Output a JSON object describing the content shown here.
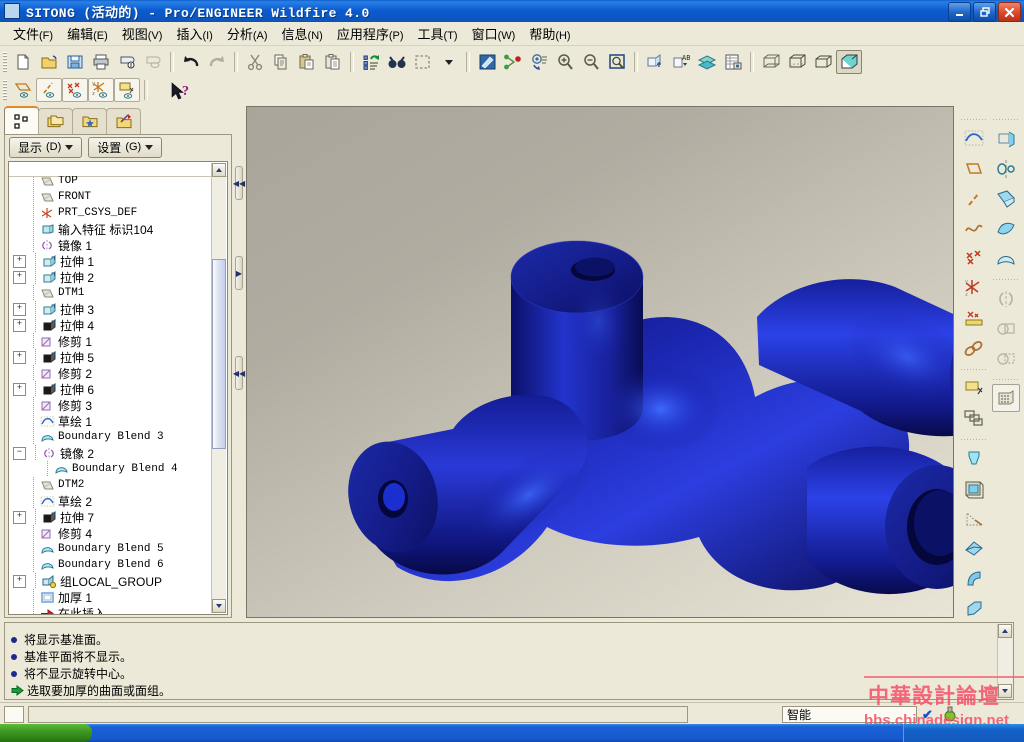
{
  "window": {
    "title": "SITONG (活动的) - Pro/ENGINEER Wildfire 4.0",
    "minimize_label": "_",
    "restore_label": "❐",
    "close_label": "✕",
    "app_icon": "part-window-icon"
  },
  "menubar": {
    "items": [
      {
        "label": "文件",
        "key": "(F)"
      },
      {
        "label": "编辑",
        "key": "(E)"
      },
      {
        "label": "视图",
        "key": "(V)"
      },
      {
        "label": "插入",
        "key": "(I)"
      },
      {
        "label": "分析",
        "key": "(A)"
      },
      {
        "label": "信息",
        "key": "(N)"
      },
      {
        "label": "应用程序",
        "key": "(P)"
      },
      {
        "label": "工具",
        "key": "(T)"
      },
      {
        "label": "窗口",
        "key": "(W)"
      },
      {
        "label": "帮助",
        "key": "(H)"
      }
    ]
  },
  "toolbar_main": {
    "buttons": [
      {
        "name": "new-file-icon",
        "title": "新建"
      },
      {
        "name": "open-file-icon",
        "title": "打开"
      },
      {
        "name": "save-icon",
        "title": "保存"
      },
      {
        "name": "print-icon",
        "title": "打印"
      },
      {
        "name": "send-mail-icon",
        "title": "发送"
      },
      {
        "name": "close-window-icon",
        "title": "关闭窗口"
      },
      {
        "name": "undo-icon",
        "title": "撤消"
      },
      {
        "name": "redo-icon",
        "title": "重做"
      },
      {
        "name": "cut-icon",
        "title": "剪切"
      },
      {
        "name": "copy-icon",
        "title": "复制"
      },
      {
        "name": "paste-icon",
        "title": "粘贴"
      },
      {
        "name": "paste-special-icon",
        "title": "选择性粘贴"
      },
      {
        "name": "regenerate-icon",
        "title": "重新生成"
      },
      {
        "name": "find-icon",
        "title": "查找"
      },
      {
        "name": "select-box-icon",
        "title": "选取框"
      },
      {
        "name": "repaint-icon",
        "title": "重画"
      },
      {
        "name": "spin-center-icon",
        "title": "旋转中心"
      },
      {
        "name": "refit-icon",
        "title": "重定向"
      },
      {
        "name": "zoom-in-icon",
        "title": "放大"
      },
      {
        "name": "zoom-out-icon",
        "title": "缩小"
      },
      {
        "name": "zoom-fit-icon",
        "title": "缩放至适合"
      },
      {
        "name": "datum-plane-display-icon",
        "title": "基准平面显示"
      },
      {
        "name": "annotation-display-icon",
        "title": "注释显示"
      },
      {
        "name": "layer-icon",
        "title": "层"
      },
      {
        "name": "view-manager-icon",
        "title": "视图管理器"
      },
      {
        "name": "wireframe-icon",
        "title": "线框"
      },
      {
        "name": "hidden-line-icon",
        "title": "隐藏线"
      },
      {
        "name": "no-hidden-icon",
        "title": "无隐藏线"
      },
      {
        "name": "shading-icon",
        "title": "着色"
      }
    ]
  },
  "toolbar_datum": {
    "buttons": [
      {
        "name": "datum-plane-icon",
        "title": "基准平面显示"
      },
      {
        "name": "datum-axis-icon",
        "title": "基准轴显示"
      },
      {
        "name": "datum-point-icon",
        "title": "基准点显示"
      },
      {
        "name": "datum-csys-icon",
        "title": "坐标系显示"
      },
      {
        "name": "annotation-icon",
        "title": "注释显示"
      },
      {
        "name": "context-help-icon",
        "title": "上下文帮助"
      }
    ]
  },
  "navigator_tabs": [
    {
      "name": "model-tree-tab",
      "label": "模型树",
      "active": true
    },
    {
      "name": "folder-browser-tab",
      "label": "文件夹浏览器",
      "active": false
    },
    {
      "name": "favorites-tab",
      "label": "收藏夹",
      "active": false
    },
    {
      "name": "connections-tab",
      "label": "连接",
      "active": false
    }
  ],
  "tree_toolbar": {
    "show_label": "显示",
    "show_key": "(D)",
    "settings_label": "设置",
    "settings_key": "(G)"
  },
  "model_tree": [
    {
      "label": "TOP",
      "icon": "datum-plane-icon",
      "toggle": "none",
      "mono": true,
      "clipped": true
    },
    {
      "label": "FRONT",
      "icon": "datum-plane-icon",
      "toggle": "none",
      "mono": true
    },
    {
      "label": "PRT_CSYS_DEF",
      "icon": "csys-icon",
      "toggle": "none",
      "mono": true
    },
    {
      "label": "输入特征 标识104",
      "icon": "import-feature-icon",
      "toggle": "none"
    },
    {
      "label": "镜像 1",
      "icon": "mirror-icon",
      "toggle": "none"
    },
    {
      "label": "拉伸 1",
      "icon": "extrude-surface-icon",
      "toggle": "plus"
    },
    {
      "label": "拉伸 2",
      "icon": "extrude-surface-icon",
      "toggle": "plus"
    },
    {
      "label": "DTM1",
      "icon": "datum-plane-icon",
      "toggle": "none",
      "mono": true
    },
    {
      "label": "拉伸 3",
      "icon": "extrude-surface-icon",
      "toggle": "plus"
    },
    {
      "label": "拉伸 4",
      "icon": "extrude-solid-icon",
      "toggle": "plus"
    },
    {
      "label": "修剪 1",
      "icon": "trim-icon",
      "toggle": "none"
    },
    {
      "label": "拉伸 5",
      "icon": "extrude-solid-icon",
      "toggle": "plus"
    },
    {
      "label": "修剪 2",
      "icon": "trim-icon",
      "toggle": "none"
    },
    {
      "label": "拉伸 6",
      "icon": "extrude-solid-icon",
      "toggle": "plus"
    },
    {
      "label": "修剪 3",
      "icon": "trim-icon",
      "toggle": "none"
    },
    {
      "label": "草绘 1",
      "icon": "sketch-icon",
      "toggle": "none"
    },
    {
      "label": "Boundary Blend 3",
      "icon": "boundary-blend-icon",
      "toggle": "none",
      "mono": true
    },
    {
      "label": "镜像 2",
      "icon": "mirror-icon",
      "toggle": "minus"
    },
    {
      "label": "Boundary Blend 4",
      "icon": "boundary-blend-icon",
      "toggle": "none",
      "mono": true,
      "indent": 1
    },
    {
      "label": "DTM2",
      "icon": "datum-plane-icon",
      "toggle": "none",
      "mono": true
    },
    {
      "label": "草绘 2",
      "icon": "sketch-icon",
      "toggle": "none"
    },
    {
      "label": "拉伸 7",
      "icon": "extrude-solid-icon",
      "toggle": "plus"
    },
    {
      "label": "修剪 4",
      "icon": "trim-icon",
      "toggle": "none"
    },
    {
      "label": "Boundary Blend 5",
      "icon": "boundary-blend-icon",
      "toggle": "none",
      "mono": true
    },
    {
      "label": "Boundary Blend 6",
      "icon": "boundary-blend-icon",
      "toggle": "none",
      "mono": true
    },
    {
      "label": "组LOCAL_GROUP",
      "icon": "group-icon",
      "toggle": "plus"
    },
    {
      "label": "加厚 1",
      "icon": "thicken-icon",
      "toggle": "none"
    },
    {
      "label": "在此插入",
      "icon": "insert-here-icon",
      "toggle": "none"
    }
  ],
  "right_toolbar": {
    "column_a": [
      {
        "name": "sketch-icon"
      },
      {
        "name": "datum-plane-icon"
      },
      {
        "name": "datum-axis-icon"
      },
      {
        "name": "curve-icon"
      },
      {
        "name": "datum-point-icon"
      },
      {
        "name": "coordinate-system-icon"
      },
      {
        "name": "analysis-point-icon"
      },
      {
        "name": "reference-chain-icon"
      },
      {
        "name": "extrude-icon"
      },
      {
        "name": "pattern-icon"
      },
      {
        "name": "hole-icon"
      },
      {
        "name": "shell-icon"
      },
      {
        "name": "rib-icon"
      },
      {
        "name": "draft-icon"
      },
      {
        "name": "round-icon"
      },
      {
        "name": "chamfer-icon"
      }
    ],
    "column_b": [
      {
        "name": "revolve-icon"
      },
      {
        "name": "revolve-feature-icon"
      },
      {
        "name": "sweep-icon"
      },
      {
        "name": "blend-icon"
      },
      {
        "name": "boundary-blend-icon"
      },
      {
        "name": "mirror-icon"
      },
      {
        "name": "merge-icon"
      },
      {
        "name": "trim-icon"
      },
      {
        "name": "pattern-table-icon"
      }
    ]
  },
  "messages": [
    {
      "type": "bullet",
      "text": "将显示基准面。"
    },
    {
      "type": "bullet",
      "text": "基准平面将不显示。"
    },
    {
      "type": "bullet",
      "text": "将不显示旋转中心。"
    },
    {
      "type": "prompt",
      "text": "选取要加厚的曲面或面组。"
    }
  ],
  "status_bar": {
    "smart_filter": "智能",
    "check_glyph": "✔",
    "lamp_icon": "status-lamp-icon"
  },
  "viewport": {
    "model_name": "four-way-pipe-junction",
    "model_color": "#1a22a8",
    "highlight_color": "#2a4ff0",
    "background_top": "#a9a59b",
    "background_bottom": "#e8e4d6",
    "display_style": "shading"
  },
  "watermark": {
    "line1": "中華設計論壇",
    "line2": "bbs.chinadesign.net",
    "color": "#f4536a"
  },
  "taskbar": {
    "start_label": ""
  }
}
